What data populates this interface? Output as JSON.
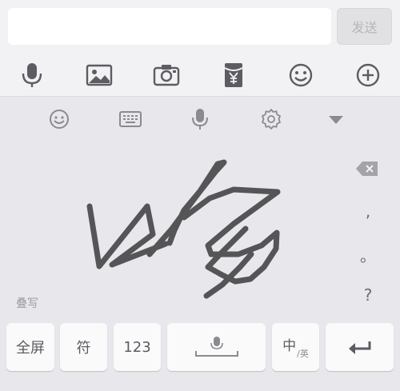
{
  "input": {
    "value": "",
    "placeholder": ""
  },
  "send_label": "发送",
  "tools": [
    {
      "icon": "microphone-icon"
    },
    {
      "icon": "image-icon"
    },
    {
      "icon": "camera-icon"
    },
    {
      "icon": "red-envelope-icon"
    },
    {
      "icon": "emoji-icon"
    },
    {
      "icon": "plus-icon"
    }
  ],
  "keyboard_toolbar": [
    {
      "icon": "emoji-icon"
    },
    {
      "icon": "keyboard-icon"
    },
    {
      "icon": "microphone-icon"
    },
    {
      "icon": "gear-icon"
    },
    {
      "icon": "triangle-down-icon"
    }
  ],
  "handwriting": {
    "mode_label": "叠写"
  },
  "punctuation": [
    ",",
    "。",
    "?"
  ],
  "keys": {
    "fullscreen": "全屏",
    "symbols": "符",
    "numbers": "123",
    "lang_primary": "中",
    "lang_secondary": "/英"
  },
  "colors": {
    "background": "#e8e8ec",
    "bar": "#f2f2f4",
    "icon": "#5c5c62",
    "stroke": "#555557"
  }
}
